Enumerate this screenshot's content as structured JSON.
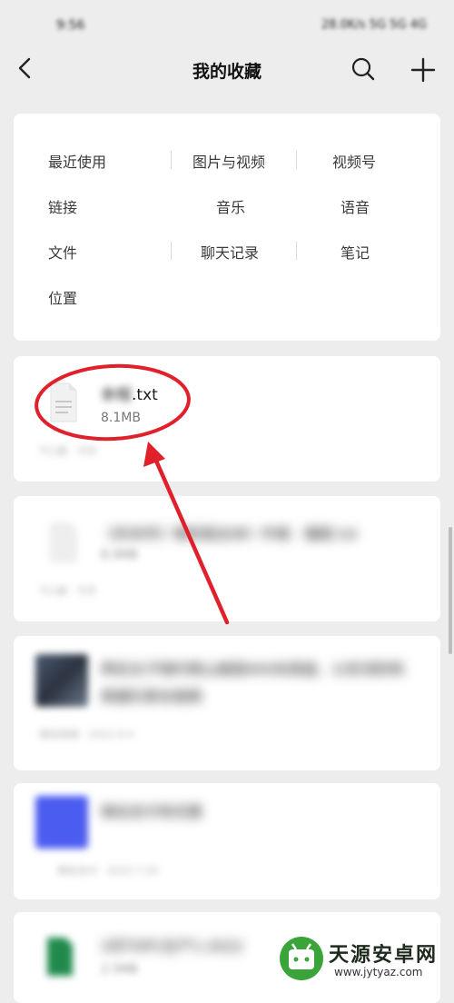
{
  "status_bar": {
    "time": "9:56",
    "indicators": "28.0K/s 5G 5G 4G"
  },
  "header": {
    "title": "我的收藏"
  },
  "filters": [
    {
      "label": "最近使用"
    },
    {
      "label": "图片与视频"
    },
    {
      "label": "视频号"
    },
    {
      "label": "链接"
    },
    {
      "label": "音乐"
    },
    {
      "label": "语音"
    },
    {
      "label": "文件"
    },
    {
      "label": "聊天记录"
    },
    {
      "label": "笔记"
    },
    {
      "label": "位置"
    }
  ],
  "items": [
    {
      "title_blurred": "余程",
      "title_ext": ".txt",
      "size": "8.1MB",
      "meta": "TCL旗 · 今天"
    },
    {
      "title": "《庆余年》精校版全本》作者：猫腻.txt",
      "size": "8.9MB",
      "meta": "TCL旗 · 今天"
    },
    {
      "title": "两名女子相约爬山被困400米高崖，公安消防和救援队联合施救",
      "meta": "微信视频 · 2022-9-4"
    },
    {
      "title": "微信支付有优惠",
      "meta": "微信支付 · 2022-7-20"
    },
    {
      "title": "3月TOP1生产1-2022",
      "size": "2.5MB"
    }
  ],
  "annotation": {
    "color": "#e0202a"
  },
  "watermark": {
    "brand": "天源安卓网",
    "url": "www.jytyaz.com"
  },
  "colors": {
    "background": "#ededed",
    "card": "#ffffff",
    "accent_red": "#e0202a",
    "watermark_green": "#3aa33a"
  }
}
